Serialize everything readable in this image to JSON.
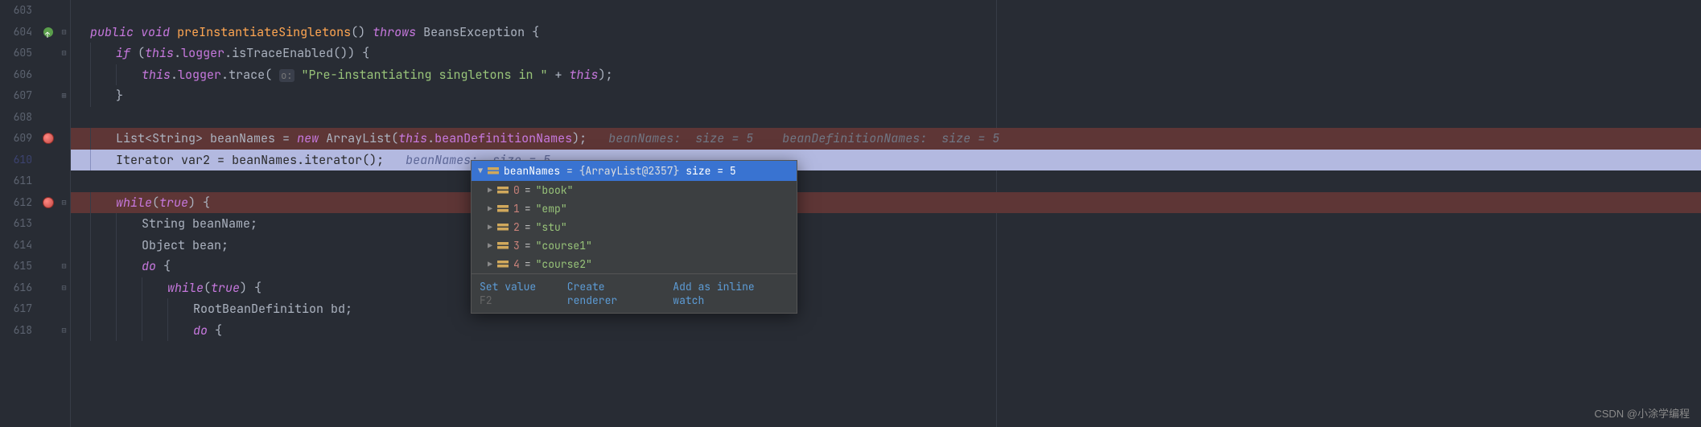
{
  "lines": {
    "l603": "603",
    "l604": "604",
    "l605": "605",
    "l606": "606",
    "l607": "607",
    "l608": "608",
    "l609": "609",
    "l610": "610",
    "l611": "611",
    "l612": "612",
    "l613": "613",
    "l614": "614",
    "l615": "615",
    "l616": "616",
    "l617": "617",
    "l618": "618"
  },
  "code": {
    "l604": {
      "public": "public",
      "void": "void",
      "method": "preInstantiateSingletons",
      "throws": "throws",
      "exc": "BeansException",
      "brace": " {"
    },
    "l605": {
      "if": "if",
      "this": "this",
      "logger": "logger",
      "isTrace": "isTraceEnabled"
    },
    "l606": {
      "this": "this",
      "logger": "logger",
      "trace": "trace",
      "hint": "o:",
      "str": "\"Pre-instantiating singletons in \"",
      "plus": " + ",
      "this2": "this"
    },
    "l609": {
      "type": "List<String>",
      "var": "beanNames",
      "eq": " = ",
      "new": "new",
      "cls": "ArrayList",
      "this": "this",
      "field": "beanDefinitionNames",
      "inlay1": "beanNames:  size = 5",
      "inlay2": "beanDefinitionNames:  size = 5"
    },
    "l610": {
      "type": "Iterator",
      "var": "var2",
      "eq": " = ",
      "bn": "beanNames",
      "iter": "iterator",
      "inlay": "beanNames:  size = 5"
    },
    "l612": {
      "while": "while",
      "true": "true"
    },
    "l613": {
      "type": "String",
      "var": "beanName"
    },
    "l614": {
      "type": "Object",
      "var": "bean"
    },
    "l615": {
      "do": "do"
    },
    "l616": {
      "while": "while",
      "true": "true"
    },
    "l617": {
      "type": "RootBeanDefinition",
      "var": "bd"
    },
    "l618": {
      "do": "do"
    }
  },
  "popup": {
    "header_var": "beanNames",
    "header_type": " = {ArrayList@2357} ",
    "header_size": " size = 5",
    "items": [
      {
        "idx": "0",
        "val": "\"book\""
      },
      {
        "idx": "1",
        "val": "\"emp\""
      },
      {
        "idx": "2",
        "val": "\"stu\""
      },
      {
        "idx": "3",
        "val": "\"course1\""
      },
      {
        "idx": "4",
        "val": "\"course2\""
      }
    ],
    "actions": {
      "setvalue": "Set value",
      "f2": "F2",
      "renderer": "Create renderer",
      "inline": "Add as inline watch"
    }
  },
  "watermark": "CSDN @小涂学编程"
}
